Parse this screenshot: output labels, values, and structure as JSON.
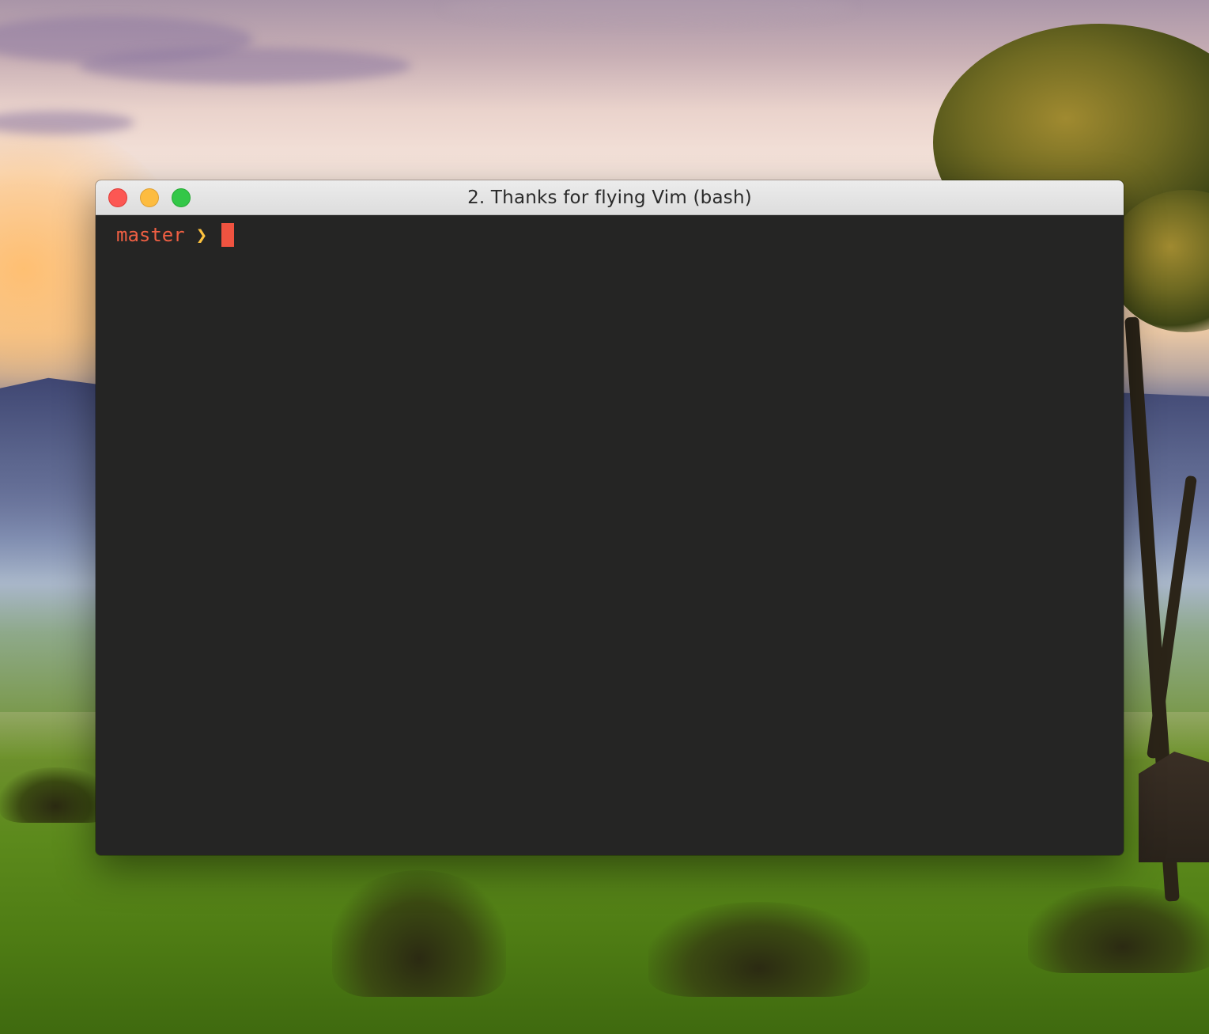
{
  "window": {
    "title": "2. Thanks for flying Vim (bash)",
    "buttons": {
      "close": "close-button",
      "minimize": "minimize-button",
      "zoom": "zoom-button"
    }
  },
  "terminal": {
    "prompt": {
      "branch": "master",
      "symbol": "❯",
      "input": ""
    },
    "colors": {
      "background": "#252524",
      "branch": "#ef5f43",
      "symbol": "#fdc23e",
      "cursor": "#f05340"
    }
  },
  "colors": {
    "close": "#fc5753",
    "minimize": "#fdbc40",
    "zoom": "#33c748"
  }
}
